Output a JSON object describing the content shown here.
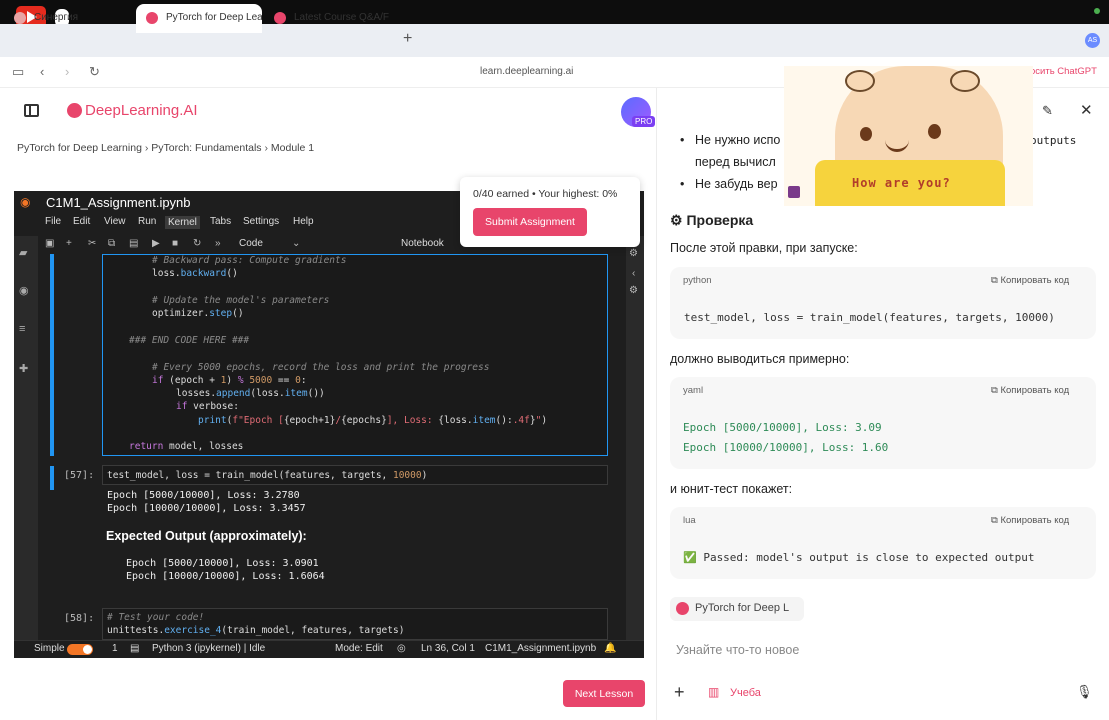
{
  "browser": {
    "tabs": [
      {
        "label": "Синергия",
        "color": "#e06464"
      },
      {
        "label": "PyTorch for Deep Lea",
        "color": "#e8456b"
      },
      {
        "label": "Latest Course Q&A/F",
        "color": "#e8456b"
      }
    ],
    "url": "learn.deeplearning.ai",
    "profile_initials": "AS"
  },
  "page": {
    "logo_text": "DeepLearning.AI",
    "pro_label": "PRO",
    "breadcrumb": [
      "PyTorch for Deep Learning",
      "PyTorch: Fundamentals",
      "Module 1"
    ],
    "submit_popup": {
      "earned": "0/40 earned • Your highest: 0%",
      "button": "Submit Assignment"
    },
    "next_lesson": "Next Lesson"
  },
  "jupyter": {
    "title": "C1M1_Assignment.ipynb",
    "menu": [
      "File",
      "Edit",
      "View",
      "Run",
      "Kernel",
      "Tabs",
      "Settings",
      "Help"
    ],
    "cell_type": "Code",
    "notebook_label": "Notebook",
    "prompt_57": "[57]:",
    "prompt_58": "[58]:",
    "output_1": "Epoch [5000/10000], Loss: 3.2780",
    "output_2": "Epoch [10000/10000], Loss: 3.3457",
    "expected_heading": "Expected Output (approximately):",
    "expected_1": "Epoch [5000/10000], Loss: 3.0901",
    "expected_2": "Epoch [10000/10000], Loss: 1.6064",
    "status": {
      "mode_name": "Simple",
      "count": "1",
      "kernel": "Python 3 (ipykernel) | Idle",
      "edit_mode": "Mode: Edit",
      "position": "Ln 36, Col 1",
      "file": "C1M1_Assignment.ipynb"
    }
  },
  "chat": {
    "bullet1": "Не нужно испо",
    "bullet1_end": "outputs",
    "bullet1_line2": "перед вычисл",
    "bullet2": "Не забудь вер",
    "chatgpt_link": "осить ChatGPT",
    "heading": "Проверка",
    "para1": "После этой правки, при запуске:",
    "block1": {
      "lang": "python",
      "code": "test_model, loss = train_model(features, targets, 10000)"
    },
    "copy_label": "Копировать код",
    "para2": "должно выводиться примерно:",
    "block2": {
      "lang": "yaml",
      "line1": "Epoch [5000/10000], Loss: 3.09",
      "line2": "Epoch [10000/10000], Loss: 1.60"
    },
    "para3": "и юнит-тест покажет:",
    "block3": {
      "lang": "lua",
      "line": "✅ Passed: model's output is close to expected output"
    },
    "chip": "PyTorch for Deep L",
    "input_placeholder": "Узнайте что-то новое",
    "study_label": "Учеба"
  },
  "overlay": {
    "caption": "How are you?"
  }
}
